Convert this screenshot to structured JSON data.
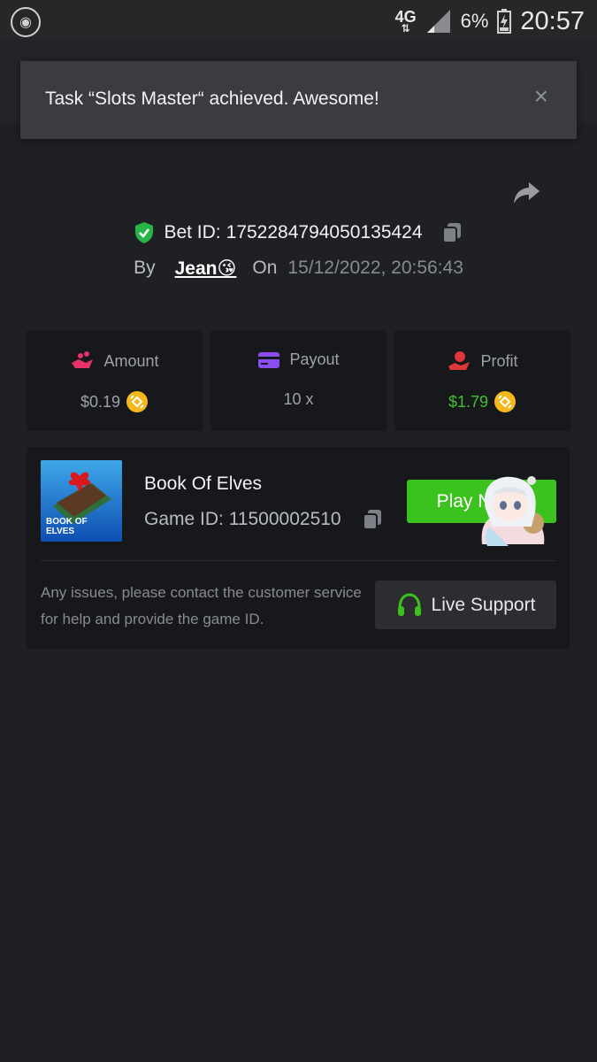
{
  "status_bar": {
    "network": "4G",
    "battery_percent": "6%",
    "time": "20:57"
  },
  "toast": {
    "message": "Task “Slots Master“ achieved. Awesome!",
    "close_glyph": "×"
  },
  "bet": {
    "label": "Bet ID:",
    "id": "1752284794050135424",
    "by_label": "By",
    "user": "Jean😘",
    "on_label": "On",
    "datetime": "15/12/2022, 20:56:43"
  },
  "stats": [
    {
      "label": "Amount",
      "value": "$0.19",
      "icon": "hand-coins-icon",
      "color": "#e8306a"
    },
    {
      "label": "Payout",
      "value": "10 x",
      "icon": "card-icon",
      "color": "#8a4df0"
    },
    {
      "label": "Profit",
      "value": "$1.79",
      "icon": "hand-money-icon",
      "color": "#e0373a"
    }
  ],
  "game": {
    "thumb_text_line1": "BOOK OF",
    "thumb_text_line2": "ELVES",
    "title": "Book Of Elves",
    "game_id": "Game ID: 11500002510",
    "play_label": "Play N",
    "issues_text": "Any issues, please contact the customer service for help and provide the game ID.",
    "support_label": "Live Support"
  },
  "colors": {
    "accent_green": "#3cc21f",
    "profit_green": "#3fc22f",
    "coin_gold": "#f3b81c",
    "shield_green": "#28b446"
  }
}
